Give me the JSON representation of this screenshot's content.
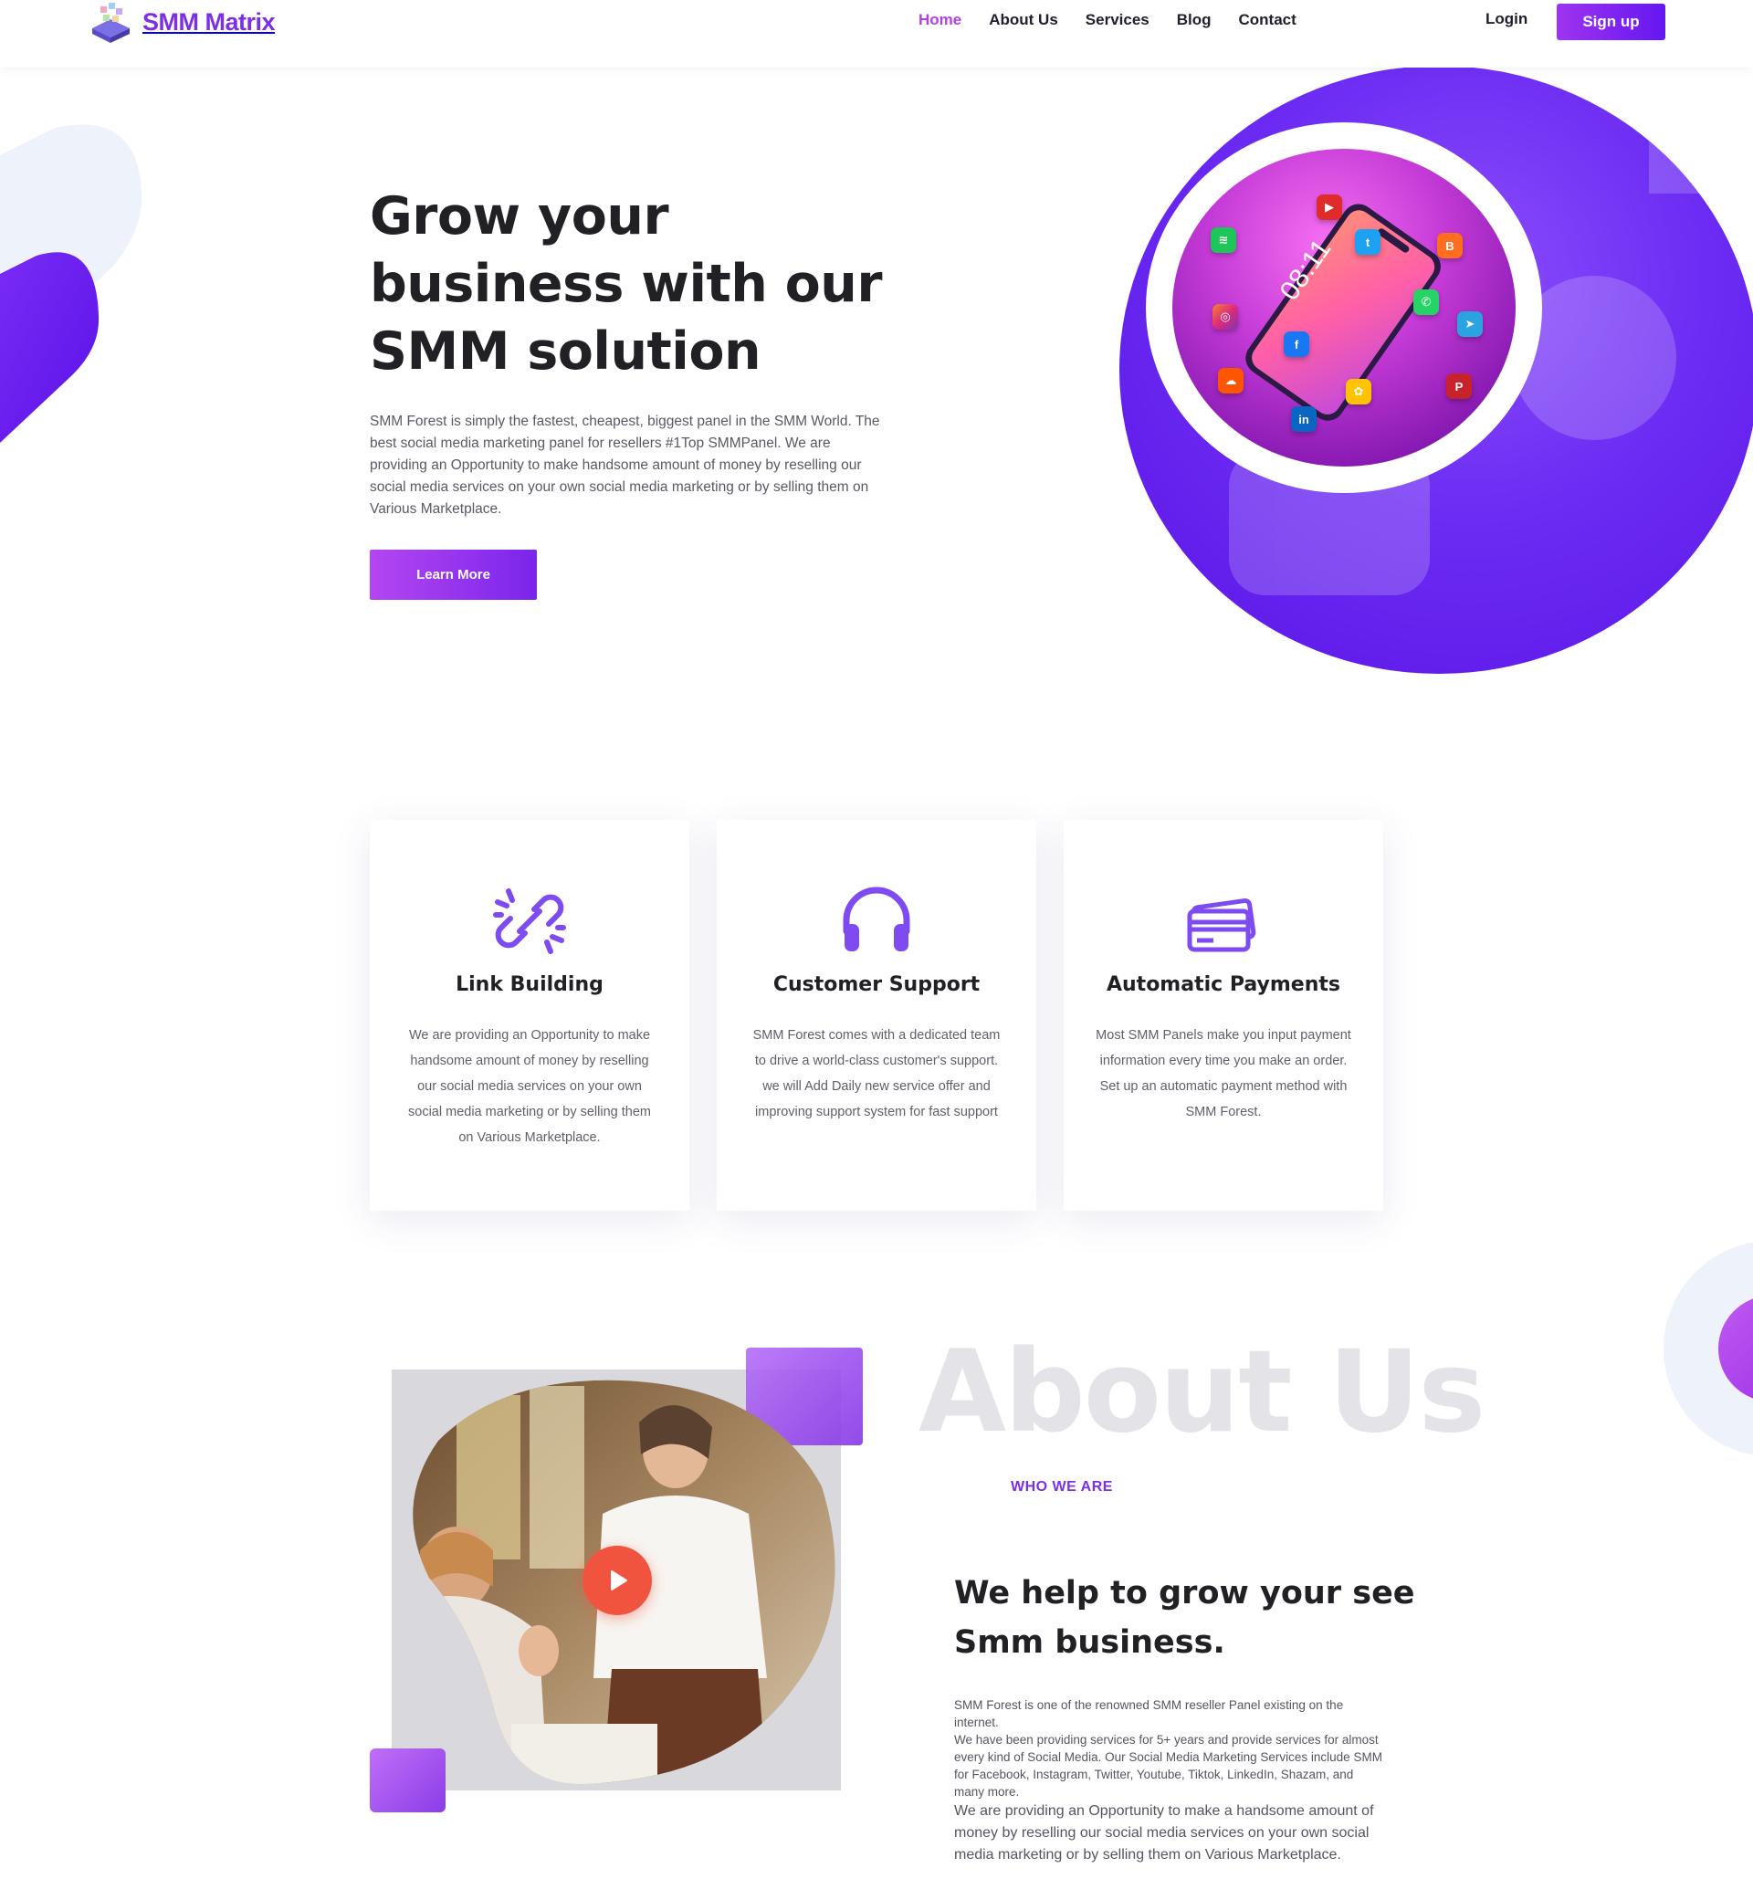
{
  "nav": {
    "logo_text": "SMM Matrix",
    "links": [
      {
        "label": "Home",
        "active": true
      },
      {
        "label": "About Us",
        "active": false
      },
      {
        "label": "Services",
        "active": false
      },
      {
        "label": "Blog",
        "active": false
      },
      {
        "label": "Contact",
        "active": false
      }
    ],
    "login_label": "Login",
    "signup_label": "Sign up"
  },
  "hero": {
    "title": "Grow your business with our SMM solution",
    "description": "SMM Forest is simply the fastest, cheapest, biggest panel in the SMM World. The best social media marketing panel for resellers #1Top SMMPanel. We are providing an Opportunity to make handsome amount of money by reselling our social media services on your own social media marketing or by selling them on Various Marketplace.",
    "cta_label": "Learn More",
    "phone_time": "08:11"
  },
  "features": [
    {
      "icon": "broken-link-icon",
      "title": "Link Building",
      "text": "We are providing an Opportunity to make handsome amount of money by reselling our social media services on your own social media marketing or by selling them on Various Marketplace."
    },
    {
      "icon": "headphones-icon",
      "title": "Customer Support",
      "text": "SMM Forest comes with a dedicated team to drive a world-class customer's support. we will Add Daily new service offer and improving support system for fast support"
    },
    {
      "icon": "credit-cards-icon",
      "title": "Automatic Payments",
      "text": "Most SMM Panels make you input payment information every time you make an order. Set up an automatic payment method with  SMM Forest."
    }
  ],
  "about": {
    "background_word": "About Us",
    "tag": "WHO WE ARE",
    "title": "We help to grow your see Smm business.",
    "text_small_1": "SMM Forest is one of the renowned SMM reseller Panel existing on the internet.",
    "text_small_2": "We have been providing services for 5+ years and provide services for almost every kind of Social Media. Our Social Media Marketing Services include SMM for Facebook, Instagram, Twitter, Youtube, Tiktok, LinkedIn, Shazam, and many more.",
    "text_large": "We are providing an Opportunity to make a handsome amount of money by reselling our social media services on your own social media marketing or by selling them on Various Marketplace."
  },
  "colors": {
    "accent": "#7b2fe6",
    "accent_light": "#b140e8",
    "hero_circle": "#6c2cf3",
    "play_button": "#f0543f",
    "text_dark": "#202025",
    "text_body": "#5f5f6a"
  }
}
